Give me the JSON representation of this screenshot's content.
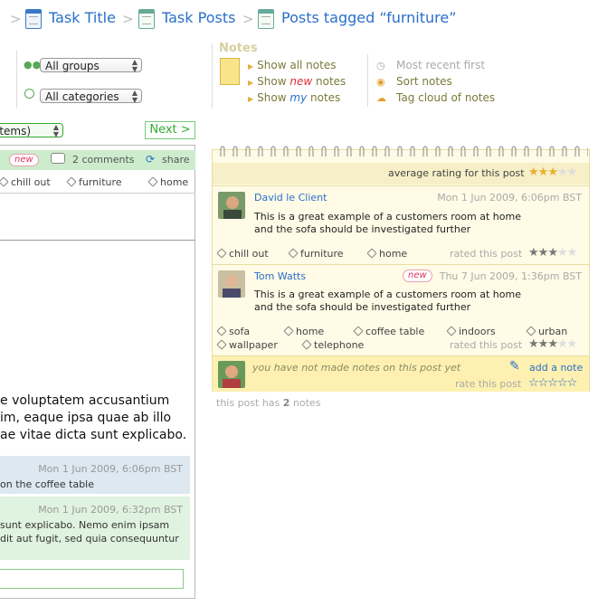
{
  "breadcrumb": {
    "items": [
      {
        "label": "Task Title"
      },
      {
        "label": "Task Posts"
      },
      {
        "label": "Posts tagged “furniture”"
      }
    ],
    "separator": ">"
  },
  "filters": {
    "groups_value": "All groups",
    "categories_value": "All categories"
  },
  "notes_menu": {
    "heading": "Notes",
    "show_all": "Show all notes",
    "show_new_prefix": "Show",
    "show_new_em": "new",
    "show_new_suffix": "notes",
    "show_my_prefix": "Show",
    "show_my_em": "my",
    "show_my_suffix": "notes",
    "most_recent": "Most recent first",
    "sort_notes": "Sort notes",
    "tag_cloud": "Tag cloud of notes"
  },
  "left": {
    "items_select": "items)",
    "next_label": "Next >",
    "new_badge": "new",
    "comments_label": "2 comments",
    "share_label": "share",
    "tags": [
      "chill out",
      "furniture",
      "home"
    ],
    "body_lines": [
      "e voluptatem accusantium",
      "im, eaque ipsa quae ab illo",
      "ae vitae dicta sunt explicabo."
    ],
    "comments": [
      {
        "date": "Mon 1 Jun 2009, 6:06pm BST",
        "lines": [
          "on the coffee table"
        ]
      },
      {
        "date": "Mon 1 Jun 2009, 6:32pm BST",
        "lines": [
          "sunt explicabo. Nemo enim ipsam",
          "dit aut fugit, sed quia consequuntur"
        ]
      }
    ]
  },
  "notes": {
    "average_label": "average rating for this post",
    "average_rating": 3,
    "entries": [
      {
        "author": "David le Client",
        "date": "Mon 1 Jun 2009, 6:06pm BST",
        "lines": [
          "This is a great example of a customers room at home",
          "and the sofa should be investigated further"
        ],
        "tags": [
          "chill out",
          "furniture",
          "home"
        ],
        "rated_label": "rated this post",
        "rating": 3,
        "is_new": false
      },
      {
        "author": "Tom Watts",
        "new_badge": "new",
        "date": "Thu 7 Jun 2009, 1:36pm BST",
        "lines": [
          "This is a great example of a customers room at home",
          "and the sofa should be investigated further"
        ],
        "tags": [
          "sofa",
          "home",
          "coffee table",
          "indoors",
          "urban",
          "wallpaper",
          "telephone"
        ],
        "rated_label": "rated this post",
        "rating": 3,
        "is_new": true
      }
    ],
    "not_made": "you have not made notes on this post yet",
    "add_note": "add a note",
    "rate_label": "rate this post",
    "footer_prefix": "this post has",
    "footer_count": "2",
    "footer_suffix": "notes"
  },
  "colors": {
    "link": "#2a6fc9",
    "notes_bg": "#fffbe6",
    "green_bar": "#cdeccd",
    "star": "#e8b030"
  }
}
